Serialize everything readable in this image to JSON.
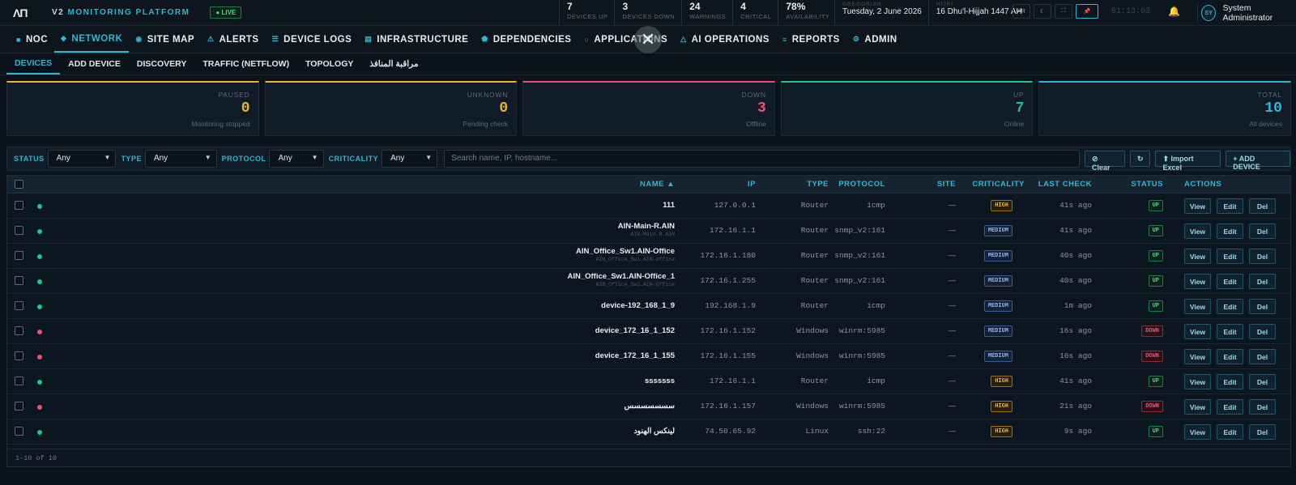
{
  "topbar": {
    "logo": "ΛΠ",
    "platform_prefix": "V2",
    "platform_name": "MONITORING PLATFORM",
    "live": "● LIVE",
    "stats": [
      {
        "value": "7",
        "label": "Devices Up"
      },
      {
        "value": "3",
        "label": "Devices Down"
      },
      {
        "value": "24",
        "label": "Warnings"
      },
      {
        "value": "4",
        "label": "Critical"
      },
      {
        "value": "78%",
        "label": "Availability"
      }
    ],
    "gregorian_label": "GREGORIAN",
    "gregorian_date": "Tuesday, 2 June 2026",
    "hijri_label": "HIJRI",
    "hijri_date": "16 Dhu'l-Hijjah 1447 AH",
    "btn_lang": "AR",
    "btn_theme": "☾",
    "btn_fullscreen": "⛶",
    "btn_pin": "📌",
    "clock": "01:13:03",
    "bell": "🔔",
    "avatar": "SY",
    "user_name": "System Administrator"
  },
  "nav": {
    "items": [
      {
        "icon": "■",
        "label": "NOC"
      },
      {
        "icon": "◆",
        "label": "NETWORK"
      },
      {
        "icon": "◉",
        "label": "SITE MAP"
      },
      {
        "icon": "⚠",
        "label": "ALERTS"
      },
      {
        "icon": "☰",
        "label": "DEVICE LOGS"
      },
      {
        "icon": "▤",
        "label": "INFRASTRUCTURE"
      },
      {
        "icon": "⬟",
        "label": "DEPENDENCIES"
      },
      {
        "icon": "○",
        "label": "APPLICATIONS"
      },
      {
        "icon": "△",
        "label": "AI OPERATIONS"
      },
      {
        "icon": "≡",
        "label": "REPORTS"
      },
      {
        "icon": "⚙",
        "label": "ADMIN"
      }
    ],
    "close": "✕"
  },
  "subnav": {
    "items": [
      "DEVICES",
      "ADD DEVICE",
      "DISCOVERY",
      "TRAFFIC (NETFLOW)",
      "TOPOLOGY",
      "مراقبة المنافذ"
    ]
  },
  "cards": [
    {
      "title": "PAUSED",
      "value": "0",
      "sub": "Monitoring stopped",
      "color": "#f0b429"
    },
    {
      "title": "UNKNOWN",
      "value": "0",
      "sub": "Pending check",
      "color": "#f0b429"
    },
    {
      "title": "DOWN",
      "value": "3",
      "sub": "Offline",
      "color": "#f0506e"
    },
    {
      "title": "UP",
      "value": "7",
      "sub": "Online",
      "color": "#22c38e"
    },
    {
      "title": "TOTAL",
      "value": "10",
      "sub": "All devices",
      "color": "#2fb8d6"
    }
  ],
  "filters": {
    "status_label": "STATUS",
    "status_value": "Any",
    "type_label": "TYPE",
    "type_value": "Any",
    "protocol_label": "PROTOCOL",
    "protocol_value": "Any",
    "criticality_label": "CRITICALITY",
    "criticality_value": "Any",
    "search_placeholder": "Search name, IP, hostname...",
    "clear": "⊘ Clear",
    "refresh": "↻",
    "import": "⬆ Import Excel",
    "add": "+ ADD DEVICE"
  },
  "table": {
    "headers": {
      "name": "NAME ▲",
      "ip": "IP",
      "type": "TYPE",
      "protocol": "PROTOCOL",
      "site": "SITE",
      "criticality": "CRITICALITY",
      "last_check": "LAST CHECK",
      "status": "STATUS",
      "actions": "ACTIONS"
    },
    "rows": [
      {
        "name": "111",
        "sub": "",
        "ip": "127.0.0.1",
        "type": "Router",
        "protocol": "icmp",
        "site": "—",
        "crit": "HIGH",
        "last": "41s ago",
        "status": "UP"
      },
      {
        "name": "AIN-Main-R.AIN",
        "sub": "AIN-Main-R.AIN",
        "ip": "172.16.1.1",
        "type": "Router",
        "protocol": "snmp_v2:161",
        "site": "—",
        "crit": "MEDIUM",
        "last": "41s ago",
        "status": "UP"
      },
      {
        "name": "AIN_Office_Sw1.AIN-Office",
        "sub": "AIN_Office_Sw1.AIN-Office",
        "ip": "172.16.1.180",
        "type": "Router",
        "protocol": "snmp_v2:161",
        "site": "—",
        "crit": "MEDIUM",
        "last": "40s ago",
        "status": "UP"
      },
      {
        "name": "AIN_Office_Sw1.AIN-Office_1",
        "sub": "AIN_Office_Sw1.AIN-Office",
        "ip": "172.16.1.255",
        "type": "Router",
        "protocol": "snmp_v2:161",
        "site": "—",
        "crit": "MEDIUM",
        "last": "40s ago",
        "status": "UP"
      },
      {
        "name": "device-192_168_1_9",
        "sub": "",
        "ip": "192.168.1.9",
        "type": "Router",
        "protocol": "icmp",
        "site": "—",
        "crit": "MEDIUM",
        "last": "1m ago",
        "status": "UP"
      },
      {
        "name": "device_172_16_1_152",
        "sub": "",
        "ip": "172.16.1.152",
        "type": "Windows",
        "protocol": "winrm:5985",
        "site": "—",
        "crit": "MEDIUM",
        "last": "16s ago",
        "status": "DOWN"
      },
      {
        "name": "device_172_16_1_155",
        "sub": "",
        "ip": "172.16.1.155",
        "type": "Windows",
        "protocol": "winrm:5985",
        "site": "—",
        "crit": "MEDIUM",
        "last": "16s ago",
        "status": "DOWN"
      },
      {
        "name": "sssssss",
        "sub": "",
        "ip": "172.16.1.1",
        "type": "Router",
        "protocol": "icmp",
        "site": "—",
        "crit": "HIGH",
        "last": "41s ago",
        "status": "UP"
      },
      {
        "name": "سسسسسسس",
        "sub": "",
        "ip": "172.16.1.157",
        "type": "Windows",
        "protocol": "winrm:5985",
        "site": "—",
        "crit": "HIGH",
        "last": "21s ago",
        "status": "DOWN"
      },
      {
        "name": "لينكس الهنود",
        "sub": "",
        "ip": "74.50.65.92",
        "type": "Linux",
        "protocol": "ssh:22",
        "site": "—",
        "crit": "HIGH",
        "last": "9s ago",
        "status": "UP"
      }
    ],
    "action_view": "View",
    "action_edit": "Edit",
    "action_del": "Del",
    "footer": "1-10 of 10"
  }
}
